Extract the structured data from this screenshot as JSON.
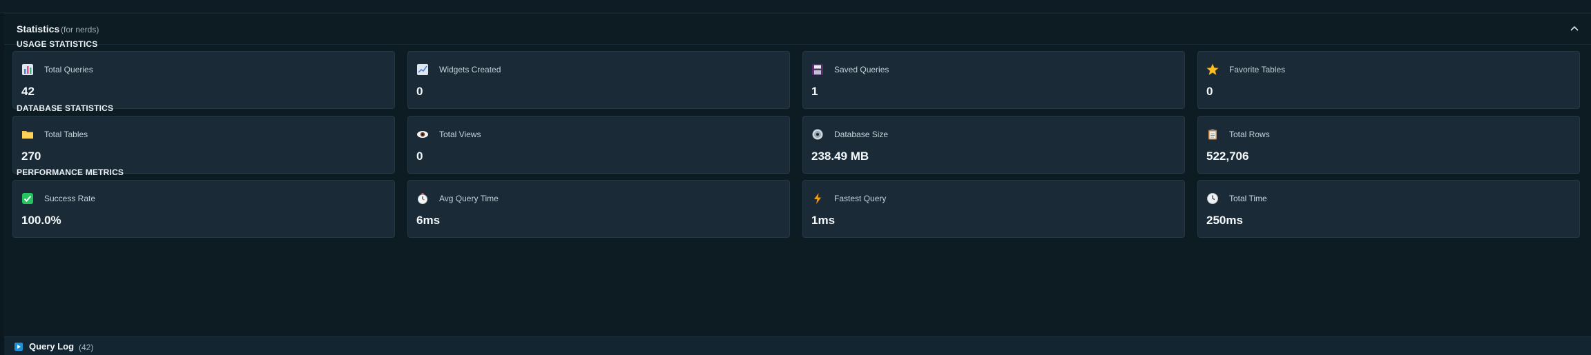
{
  "panel": {
    "title": "Statistics",
    "subtitle": "(for nerds)"
  },
  "sections": [
    {
      "label": "USAGE STATISTICS",
      "cards": [
        {
          "label": "Total Queries",
          "value": "42",
          "icon": "bar-chart-icon"
        },
        {
          "label": "Widgets Created",
          "value": "0",
          "icon": "line-chart-icon"
        },
        {
          "label": "Saved Queries",
          "value": "1",
          "icon": "floppy-disk-icon"
        },
        {
          "label": "Favorite Tables",
          "value": "0",
          "icon": "star-icon"
        }
      ]
    },
    {
      "label": "DATABASE STATISTICS",
      "cards": [
        {
          "label": "Total Tables",
          "value": "270",
          "icon": "folder-icon"
        },
        {
          "label": "Total Views",
          "value": "0",
          "icon": "eye-icon"
        },
        {
          "label": "Database Size",
          "value": "238.49 MB",
          "icon": "disc-icon"
        },
        {
          "label": "Total Rows",
          "value": "522,706",
          "icon": "clipboard-icon"
        }
      ]
    },
    {
      "label": "PERFORMANCE METRICS",
      "cards": [
        {
          "label": "Success Rate",
          "value": "100.0%",
          "icon": "check-box-icon"
        },
        {
          "label": "Avg Query Time",
          "value": "6ms",
          "icon": "stopwatch-icon"
        },
        {
          "label": "Fastest Query",
          "value": "1ms",
          "icon": "lightning-icon"
        },
        {
          "label": "Total Time",
          "value": "250ms",
          "icon": "clock-icon"
        }
      ]
    }
  ],
  "query_log": {
    "title": "Query Log",
    "count": "(42)",
    "icon": "play-icon"
  },
  "colors": {
    "background": "#0b1820",
    "card": "#1a2b37",
    "accent_blue": "#1f8fd6",
    "success_green": "#22c55e",
    "lightning_orange": "#f59e0b"
  }
}
